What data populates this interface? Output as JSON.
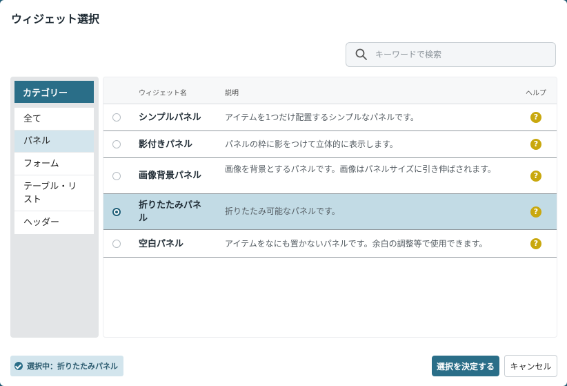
{
  "dialog": {
    "title": "ウィジェット選択"
  },
  "search": {
    "placeholder": "キーワードで検索",
    "value": ""
  },
  "category": {
    "header": "カテゴリー",
    "items": [
      {
        "label": "全て",
        "active": false
      },
      {
        "label": "パネル",
        "active": true
      },
      {
        "label": "フォーム",
        "active": false
      },
      {
        "label": "テーブル・リスト",
        "active": false
      },
      {
        "label": "ヘッダー",
        "active": false
      }
    ]
  },
  "table": {
    "columns": {
      "name": "ウィジェット名",
      "description": "説明",
      "help": "ヘルプ"
    },
    "rows": [
      {
        "name": "シンプルパネル",
        "description": "アイテムを1つだけ配置するシンプルなパネルです。",
        "selected": false
      },
      {
        "name": "影付きパネル",
        "description": "パネルの枠に影をつけて立体的に表示します。",
        "selected": false
      },
      {
        "name": "画像背景パネル",
        "description": "画像を背景とするパネルです。画像はパネルサイズに引き伸ばされます。",
        "selected": false
      },
      {
        "name": "折りたたみパネル",
        "description": "折りたたみ可能なパネルです。",
        "selected": true
      },
      {
        "name": "空白パネル",
        "description": "アイテムをなにも置かないパネルです。余白の調整等で使用できます。",
        "selected": false
      }
    ],
    "help_icon_glyph": "?"
  },
  "footer": {
    "selected_label": "選択中：折りたたみパネル",
    "confirm_label": "選択を決定する",
    "cancel_label": "キャンセル"
  },
  "colors": {
    "accent": "#2a6e88",
    "selected_row": "#c2dbe5",
    "help_icon": "#c9a80e"
  }
}
